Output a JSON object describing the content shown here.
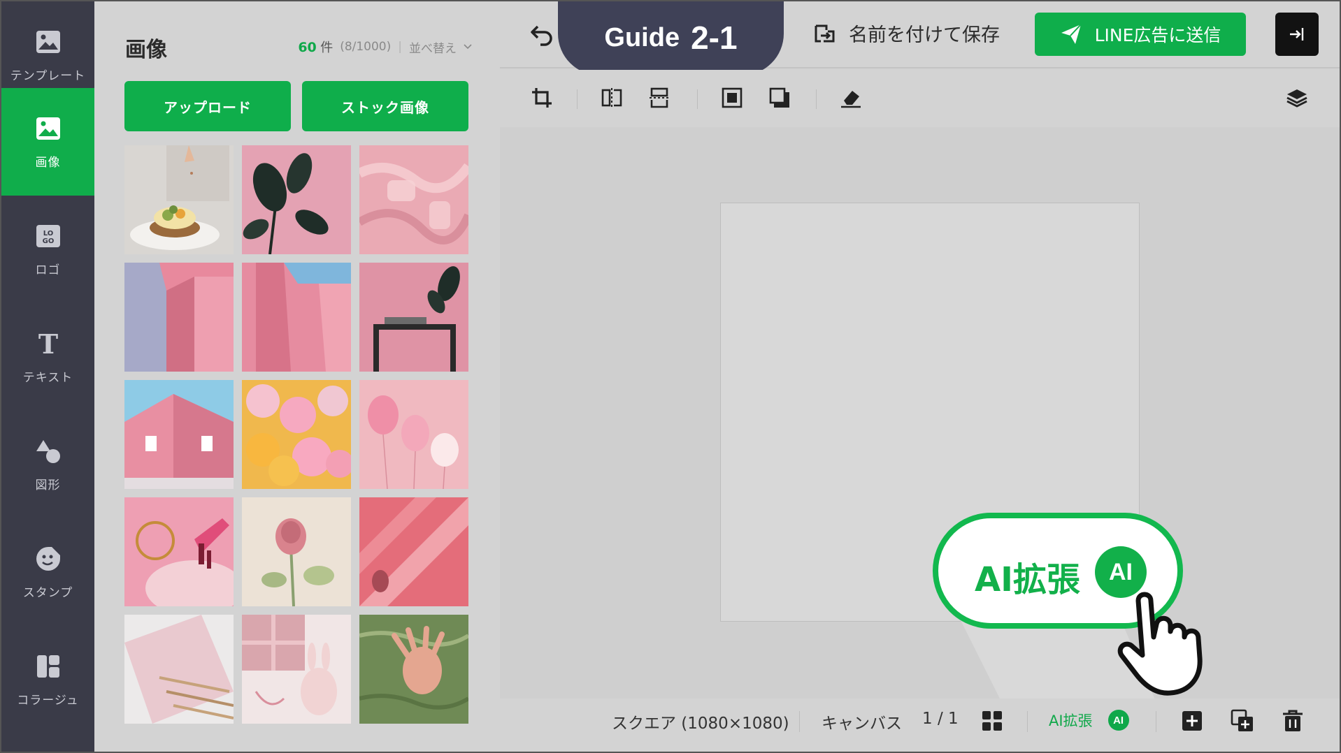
{
  "guide": {
    "label": "Guide",
    "number": "2-1"
  },
  "sidebar": {
    "items": [
      {
        "label": "テンプレート",
        "icon": "image-template-icon"
      },
      {
        "label": "画像",
        "icon": "image-icon",
        "active": true
      },
      {
        "label": "ロゴ",
        "icon": "logo-icon"
      },
      {
        "label": "テキスト",
        "icon": "text-icon"
      },
      {
        "label": "図形",
        "icon": "shapes-icon"
      },
      {
        "label": "スタンプ",
        "icon": "sticker-icon"
      },
      {
        "label": "コラージュ",
        "icon": "collage-icon"
      }
    ]
  },
  "panel": {
    "title": "画像",
    "count": "60",
    "count_unit": "件",
    "usage": "(8/1000)",
    "sort_label": "並べ替え",
    "upload_label": "アップロード",
    "stock_label": "ストック画像",
    "thumbnails": [
      "food-photo",
      "plant-photo",
      "pink-fabric-photo",
      "pink-wall-photo",
      "pink-building-sky-photo",
      "plant-shelf-photo",
      "pink-house-photo",
      "smiley-balloons-photo",
      "pink-balloons-photo",
      "pink-accessories-photo",
      "rose-photo",
      "pink-stripe-photo",
      "notebook-photo",
      "gift-bunny-photo",
      "hand-in-water-photo"
    ]
  },
  "topbar": {
    "save_as_label": "名前を付けて保存",
    "send_label": "LINE広告に送信"
  },
  "callout": {
    "label": "AI拡張",
    "badge": "AI"
  },
  "bottombar": {
    "size_label": "スクエア (1080×1080)",
    "canvas_label": "キャンバス",
    "page_indicator": "1 / 1",
    "ai_label": "AI拡張",
    "ai_badge": "AI"
  },
  "colors": {
    "accent": "#10ad4b",
    "rail": "#3a3b48",
    "guide": "#3f4157"
  }
}
